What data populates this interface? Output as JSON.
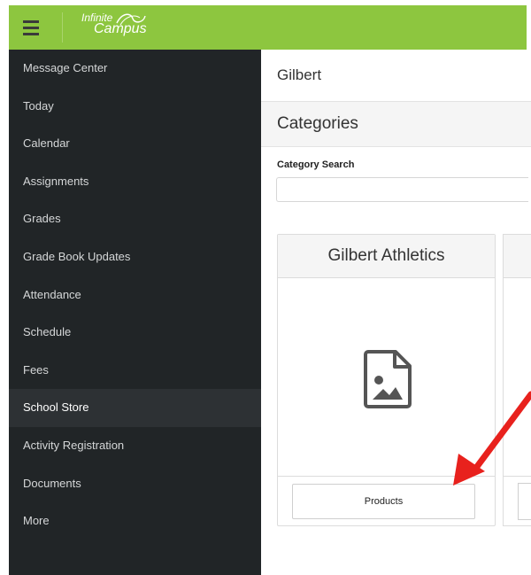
{
  "app": {
    "logo_line1": "Infinite",
    "logo_line2": "Campus",
    "accent_color": "#8dc63f",
    "sidebar_color": "#212527"
  },
  "sidebar": {
    "items": [
      {
        "label": "Message Center",
        "active": false
      },
      {
        "label": "Today",
        "active": false
      },
      {
        "label": "Calendar",
        "active": false
      },
      {
        "label": "Assignments",
        "active": false
      },
      {
        "label": "Grades",
        "active": false
      },
      {
        "label": "Grade Book Updates",
        "active": false
      },
      {
        "label": "Attendance",
        "active": false
      },
      {
        "label": "Schedule",
        "active": false
      },
      {
        "label": "Fees",
        "active": false
      },
      {
        "label": "School Store",
        "active": true
      },
      {
        "label": "Activity Registration",
        "active": false
      },
      {
        "label": "Documents",
        "active": false
      },
      {
        "label": "More",
        "active": false
      }
    ]
  },
  "main": {
    "page_title": "Gilbert",
    "section_title": "Categories",
    "search_label": "Category Search",
    "search_value": "",
    "cards": [
      {
        "title": "Gilbert Athletics",
        "image_icon": "image-placeholder-icon",
        "button_label": "Products"
      }
    ]
  },
  "annotation": {
    "arrow_color": "#e8211d"
  }
}
